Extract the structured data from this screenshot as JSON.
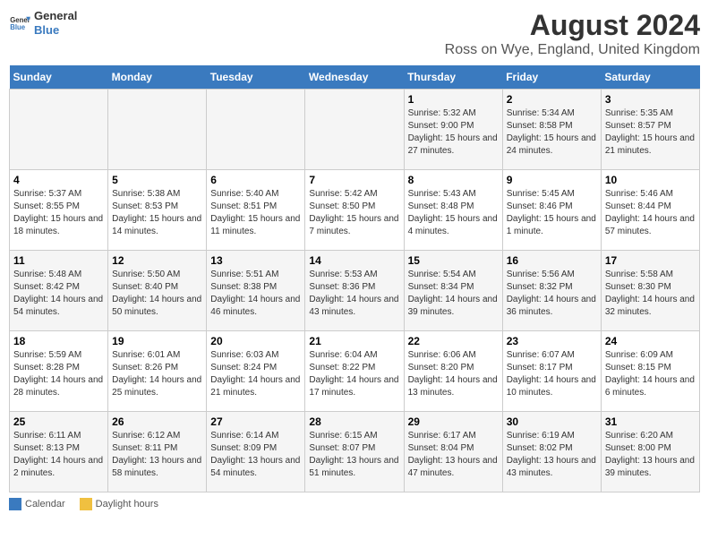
{
  "logo": {
    "line1": "General",
    "line2": "Blue"
  },
  "title": "August 2024",
  "subtitle": "Ross on Wye, England, United Kingdom",
  "days_of_week": [
    "Sunday",
    "Monday",
    "Tuesday",
    "Wednesday",
    "Thursday",
    "Friday",
    "Saturday"
  ],
  "weeks": [
    [
      {
        "day": "",
        "info": ""
      },
      {
        "day": "",
        "info": ""
      },
      {
        "day": "",
        "info": ""
      },
      {
        "day": "",
        "info": ""
      },
      {
        "day": "1",
        "info": "Sunrise: 5:32 AM\nSunset: 9:00 PM\nDaylight: 15 hours and 27 minutes."
      },
      {
        "day": "2",
        "info": "Sunrise: 5:34 AM\nSunset: 8:58 PM\nDaylight: 15 hours and 24 minutes."
      },
      {
        "day": "3",
        "info": "Sunrise: 5:35 AM\nSunset: 8:57 PM\nDaylight: 15 hours and 21 minutes."
      }
    ],
    [
      {
        "day": "4",
        "info": "Sunrise: 5:37 AM\nSunset: 8:55 PM\nDaylight: 15 hours and 18 minutes."
      },
      {
        "day": "5",
        "info": "Sunrise: 5:38 AM\nSunset: 8:53 PM\nDaylight: 15 hours and 14 minutes."
      },
      {
        "day": "6",
        "info": "Sunrise: 5:40 AM\nSunset: 8:51 PM\nDaylight: 15 hours and 11 minutes."
      },
      {
        "day": "7",
        "info": "Sunrise: 5:42 AM\nSunset: 8:50 PM\nDaylight: 15 hours and 7 minutes."
      },
      {
        "day": "8",
        "info": "Sunrise: 5:43 AM\nSunset: 8:48 PM\nDaylight: 15 hours and 4 minutes."
      },
      {
        "day": "9",
        "info": "Sunrise: 5:45 AM\nSunset: 8:46 PM\nDaylight: 15 hours and 1 minute."
      },
      {
        "day": "10",
        "info": "Sunrise: 5:46 AM\nSunset: 8:44 PM\nDaylight: 14 hours and 57 minutes."
      }
    ],
    [
      {
        "day": "11",
        "info": "Sunrise: 5:48 AM\nSunset: 8:42 PM\nDaylight: 14 hours and 54 minutes."
      },
      {
        "day": "12",
        "info": "Sunrise: 5:50 AM\nSunset: 8:40 PM\nDaylight: 14 hours and 50 minutes."
      },
      {
        "day": "13",
        "info": "Sunrise: 5:51 AM\nSunset: 8:38 PM\nDaylight: 14 hours and 46 minutes."
      },
      {
        "day": "14",
        "info": "Sunrise: 5:53 AM\nSunset: 8:36 PM\nDaylight: 14 hours and 43 minutes."
      },
      {
        "day": "15",
        "info": "Sunrise: 5:54 AM\nSunset: 8:34 PM\nDaylight: 14 hours and 39 minutes."
      },
      {
        "day": "16",
        "info": "Sunrise: 5:56 AM\nSunset: 8:32 PM\nDaylight: 14 hours and 36 minutes."
      },
      {
        "day": "17",
        "info": "Sunrise: 5:58 AM\nSunset: 8:30 PM\nDaylight: 14 hours and 32 minutes."
      }
    ],
    [
      {
        "day": "18",
        "info": "Sunrise: 5:59 AM\nSunset: 8:28 PM\nDaylight: 14 hours and 28 minutes."
      },
      {
        "day": "19",
        "info": "Sunrise: 6:01 AM\nSunset: 8:26 PM\nDaylight: 14 hours and 25 minutes."
      },
      {
        "day": "20",
        "info": "Sunrise: 6:03 AM\nSunset: 8:24 PM\nDaylight: 14 hours and 21 minutes."
      },
      {
        "day": "21",
        "info": "Sunrise: 6:04 AM\nSunset: 8:22 PM\nDaylight: 14 hours and 17 minutes."
      },
      {
        "day": "22",
        "info": "Sunrise: 6:06 AM\nSunset: 8:20 PM\nDaylight: 14 hours and 13 minutes."
      },
      {
        "day": "23",
        "info": "Sunrise: 6:07 AM\nSunset: 8:17 PM\nDaylight: 14 hours and 10 minutes."
      },
      {
        "day": "24",
        "info": "Sunrise: 6:09 AM\nSunset: 8:15 PM\nDaylight: 14 hours and 6 minutes."
      }
    ],
    [
      {
        "day": "25",
        "info": "Sunrise: 6:11 AM\nSunset: 8:13 PM\nDaylight: 14 hours and 2 minutes."
      },
      {
        "day": "26",
        "info": "Sunrise: 6:12 AM\nSunset: 8:11 PM\nDaylight: 13 hours and 58 minutes."
      },
      {
        "day": "27",
        "info": "Sunrise: 6:14 AM\nSunset: 8:09 PM\nDaylight: 13 hours and 54 minutes."
      },
      {
        "day": "28",
        "info": "Sunrise: 6:15 AM\nSunset: 8:07 PM\nDaylight: 13 hours and 51 minutes."
      },
      {
        "day": "29",
        "info": "Sunrise: 6:17 AM\nSunset: 8:04 PM\nDaylight: 13 hours and 47 minutes."
      },
      {
        "day": "30",
        "info": "Sunrise: 6:19 AM\nSunset: 8:02 PM\nDaylight: 13 hours and 43 minutes."
      },
      {
        "day": "31",
        "info": "Sunrise: 6:20 AM\nSunset: 8:00 PM\nDaylight: 13 hours and 39 minutes."
      }
    ]
  ],
  "footer": {
    "calendar_label": "Calendar",
    "daylight_label": "Daylight hours"
  }
}
